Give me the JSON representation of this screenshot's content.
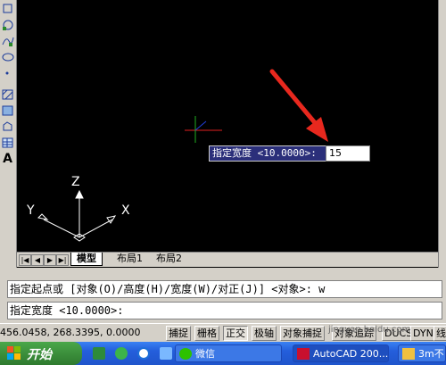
{
  "ucs": {
    "y_label": "Y",
    "z_label": "Z",
    "x_label": "X"
  },
  "dynamic_input": {
    "prompt": "指定宽度 <10.0000>:",
    "value": "15"
  },
  "tabs": [
    {
      "label": "模型",
      "active": true
    },
    {
      "label": "布局1",
      "active": false
    },
    {
      "label": "布局2",
      "active": false
    }
  ],
  "command": {
    "history": "指定起点或 [对象(O)/高度(H)/宽度(W)/对正(J)] <对象>: w",
    "current": "指定宽度 <10.0000>:"
  },
  "status": {
    "coordinates": "456.0458,  268.3395, 0.0000",
    "buttons": [
      {
        "label": "捕捉",
        "on": false
      },
      {
        "label": "栅格",
        "on": false
      },
      {
        "label": "正交",
        "on": true
      },
      {
        "label": "极轴",
        "on": false
      },
      {
        "label": "对象捕捉",
        "on": false
      },
      {
        "label": "对象追踪",
        "on": false
      },
      {
        "label": "DUCS",
        "on": false
      },
      {
        "label": "DYN",
        "on": false
      },
      {
        "label": "线",
        "on": false
      }
    ]
  },
  "taskbar": {
    "start_label": "开始",
    "tasks": [
      {
        "label": "微信",
        "active": false
      },
      {
        "label": "AutoCAD 200...",
        "active": true
      },
      {
        "label": "3m不",
        "active": false
      }
    ]
  },
  "watermark": "jingyan.baidu.com",
  "colors": {
    "arrow": "#e8281e",
    "prompt_bg": "#2b2f7a",
    "taskbar": "#245edb",
    "start": "#3c8f3c"
  }
}
